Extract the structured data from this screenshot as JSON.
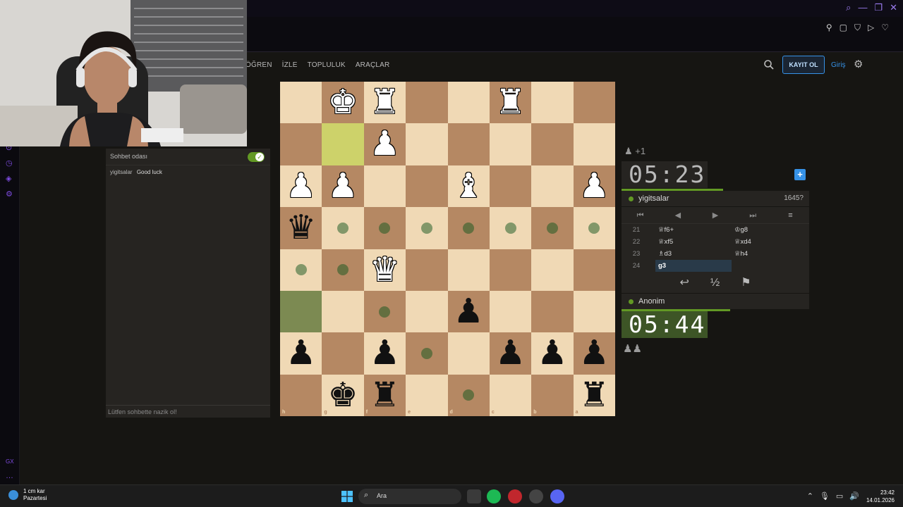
{
  "nav": {
    "items": [
      "ÖĞREN",
      "İZLE",
      "TOPLULUK",
      "ARAÇLAR"
    ],
    "register_label": "KAYIT OL",
    "login_label": "Giriş"
  },
  "chat": {
    "title": "Sohbet odası",
    "messages": [
      {
        "user": "yigitsalar",
        "text": "Good luck"
      }
    ],
    "placeholder": "Lütfen sohbette nazik ol!"
  },
  "board": {
    "orientation": "black",
    "ranks_labels": [
      "1",
      "2",
      "3",
      "4",
      "5",
      "6",
      "7",
      "8"
    ],
    "files_labels": [
      "h",
      "g",
      "f",
      "e",
      "d",
      "c",
      "b",
      "a"
    ],
    "highlight": [
      "g2"
    ],
    "selected": [
      "h6"
    ],
    "pieces": [
      {
        "square": "g1",
        "piece": "K",
        "color": "w"
      },
      {
        "square": "f1",
        "piece": "R",
        "color": "w"
      },
      {
        "square": "c1",
        "piece": "R",
        "color": "w"
      },
      {
        "square": "f2",
        "piece": "P",
        "color": "w"
      },
      {
        "square": "h3",
        "piece": "P",
        "color": "w"
      },
      {
        "square": "g3",
        "piece": "P",
        "color": "w"
      },
      {
        "square": "d3",
        "piece": "B",
        "color": "w"
      },
      {
        "square": "a3",
        "piece": "P",
        "color": "w"
      },
      {
        "square": "h4",
        "piece": "Q",
        "color": "b"
      },
      {
        "square": "f5",
        "piece": "Q",
        "color": "w"
      },
      {
        "square": "d6",
        "piece": "P",
        "color": "b"
      },
      {
        "square": "h7",
        "piece": "P",
        "color": "b"
      },
      {
        "square": "f7",
        "piece": "P",
        "color": "b"
      },
      {
        "square": "c7",
        "piece": "P",
        "color": "b"
      },
      {
        "square": "b7",
        "piece": "P",
        "color": "b"
      },
      {
        "square": "a7",
        "piece": "P",
        "color": "b"
      },
      {
        "square": "g8",
        "piece": "K",
        "color": "b"
      },
      {
        "square": "f8",
        "piece": "R",
        "color": "b"
      },
      {
        "square": "a8",
        "piece": "R",
        "color": "b"
      }
    ],
    "move_dots": [
      "g4",
      "f4",
      "e4",
      "d4",
      "c4",
      "b4",
      "a4",
      "h5",
      "g5",
      "f6",
      "e7",
      "d8"
    ]
  },
  "top_player": {
    "captured": "♟ +1",
    "clock": "05:23",
    "name": "yigitsalar",
    "rating": "1645?"
  },
  "bottom_player": {
    "name": "Anonim",
    "clock": "05:44",
    "captured": "♟♟"
  },
  "moves": [
    {
      "num": "21",
      "white": "♕f6+",
      "black": "♔g8"
    },
    {
      "num": "22",
      "white": "♕xf5",
      "black": "♕xd4"
    },
    {
      "num": "23",
      "white": "♗d3",
      "black": "♕h4"
    },
    {
      "num": "24",
      "white": "g3",
      "black": ""
    }
  ],
  "move_controls": [
    "⏮",
    "◀",
    "▶",
    "⏭",
    "≡"
  ],
  "game_actions": [
    "↩",
    "½",
    "⚑"
  ],
  "taskbar": {
    "weather_line1": "1 cm kar",
    "weather_line2": "Pazartesi",
    "search_label": "Ara",
    "time": "23:42",
    "date": "14.01.2026"
  }
}
